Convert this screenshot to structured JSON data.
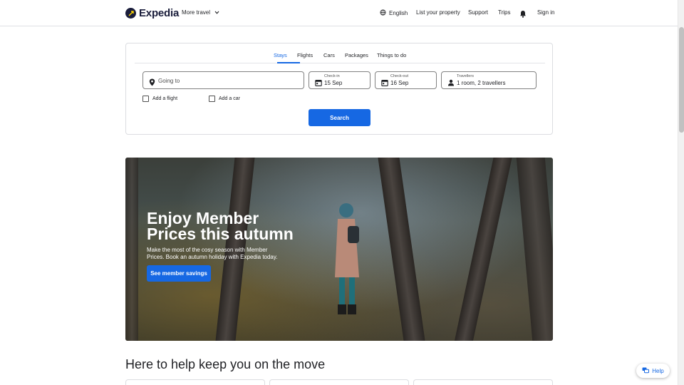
{
  "header": {
    "logo_text": "Expedia",
    "more_travel": "More travel",
    "language": "English",
    "list_property": "List your property",
    "support": "Support",
    "trips": "Trips",
    "sign_in": "Sign in"
  },
  "search": {
    "tabs": [
      "Stays",
      "Flights",
      "Cars",
      "Packages",
      "Things to do"
    ],
    "active_tab": "Stays",
    "destination_placeholder": "Going to",
    "checkin_label": "Check-in",
    "checkin_value": "15 Sep",
    "checkout_label": "Check-out",
    "checkout_value": "16 Sep",
    "travellers_label": "Travellers",
    "travellers_value": "1 room, 2 travellers",
    "add_flight": "Add a flight",
    "add_car": "Add a car",
    "search_button": "Search"
  },
  "hero": {
    "title": "Enjoy Member Prices this autumn",
    "subtitle": "Make the most of the cosy season with Member Prices. Book an autumn holiday with Expedia today.",
    "button": "See member savings"
  },
  "section": {
    "title": "Here to help keep you on the move"
  },
  "help": {
    "label": "Help"
  },
  "colors": {
    "brand_blue": "#1668e3",
    "logo_navy": "#1a1d3b"
  }
}
